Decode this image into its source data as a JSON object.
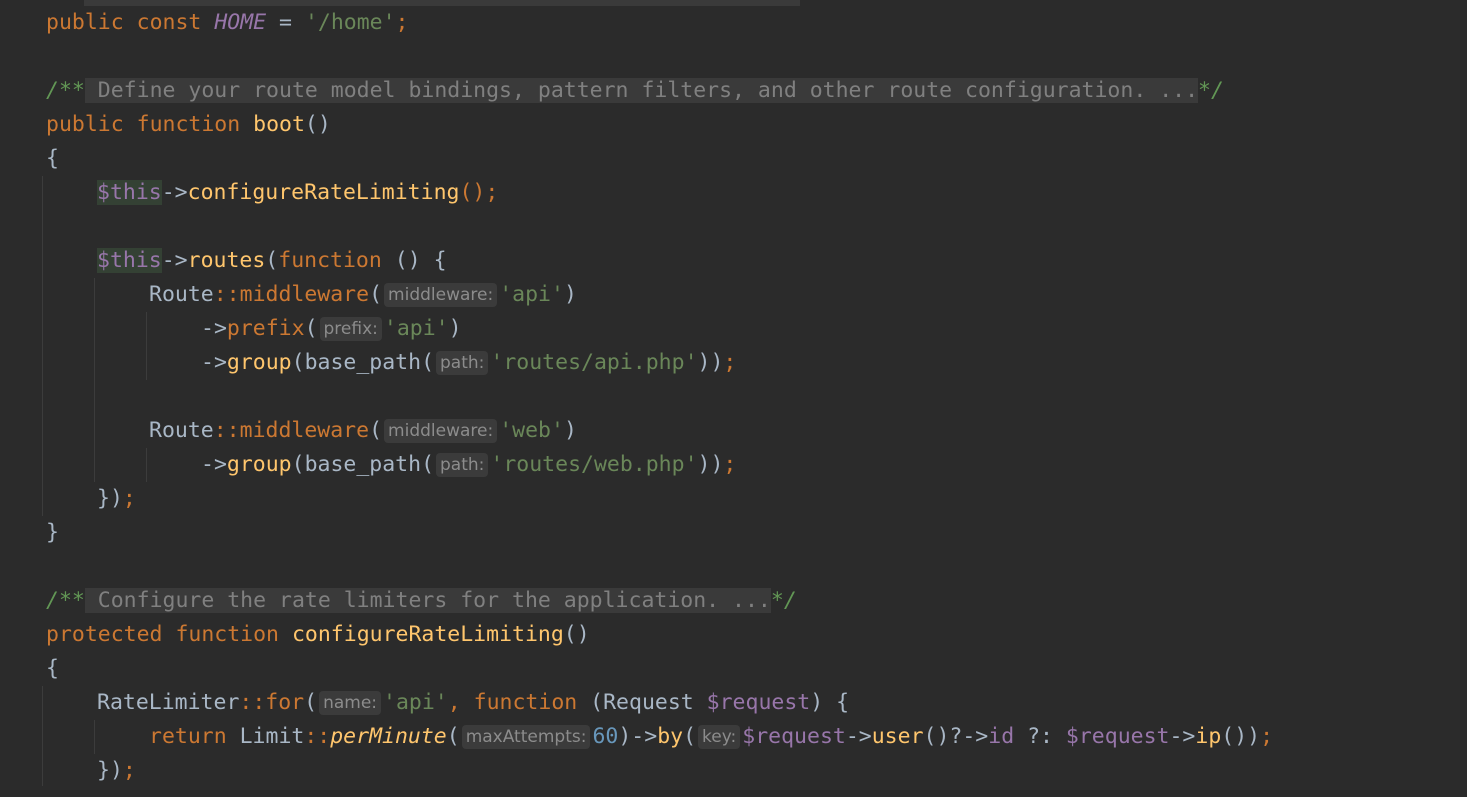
{
  "editor": {
    "l_home": {
      "kw1": "public",
      "kw2": "const",
      "name": "HOME",
      "eq": " = ",
      "val": "'/home'",
      "semi": ";"
    },
    "l_doc1": {
      "open": "/**",
      "text": " Define your route model bindings, pattern filters, and other route configuration. ...",
      "close": "*/"
    },
    "l_boot": {
      "kw1": "public",
      "kw2": "function",
      "name": "boot",
      "parens": "()"
    },
    "l_brace_open": "{",
    "l_crl": {
      "this": "$this",
      "arrow": "->",
      "method": "configureRateLimiting",
      "tail": "();"
    },
    "l_routes": {
      "this": "$this",
      "arrow": "->",
      "method": "routes",
      "paren": "(",
      "kw": "function",
      "tail": " () {"
    },
    "l_mw1": {
      "cls": "Route",
      "sep": "::",
      "method": "middleware",
      "paren": "(",
      "hint": "middleware:",
      "arg": "'api'",
      "close": ")"
    },
    "l_prefix": {
      "arrow": "->",
      "method": "prefix",
      "paren": "(",
      "hint": "prefix:",
      "arg": "'api'",
      "close": ")"
    },
    "l_group1": {
      "arrow": "->",
      "method": "group",
      "open": "(base_path(",
      "hint": "path:",
      "arg": "'routes/api.php'",
      "close": "))",
      "semi": ";"
    },
    "l_mw2": {
      "cls": "Route",
      "sep": "::",
      "method": "middleware",
      "paren": "(",
      "hint": "middleware:",
      "arg": "'web'",
      "close": ")"
    },
    "l_group2": {
      "arrow": "->",
      "method": "group",
      "open": "(base_path(",
      "hint": "path:",
      "arg": "'routes/web.php'",
      "close": "))",
      "semi": ";"
    },
    "l_close_routes": {
      "text": "})",
      "semi": ";"
    },
    "l_brace_close": "}",
    "l_doc2": {
      "open": "/**",
      "text": " Configure the rate limiters for the application. ...",
      "close": "*/"
    },
    "l_crl_def": {
      "kw1": "protected",
      "kw2": "function",
      "name": "configureRateLimiting",
      "parens": "()"
    },
    "l_brace_open2": "{",
    "l_rlfor": {
      "cls": "RateLimiter",
      "sep": "::",
      "method": "for",
      "paren": "(",
      "hint": "name:",
      "arg": "'api'",
      "comma": ", ",
      "kw": "function",
      "sig": " (Request ",
      "var": "$request",
      "tail": ") {"
    },
    "l_return": {
      "kw": "return",
      "cls": " Limit",
      "sep": "::",
      "method": "perMinute",
      "paren": "(",
      "hint1": "maxAttempts:",
      "num": "60",
      "mid": ")->",
      "method2": "by",
      "paren2": "(",
      "hint2": "key:",
      "var1": "$request",
      "arrow1": "->",
      "method3": "user",
      "mid2": "()?->",
      "prop": "id",
      "elvis": " ?: ",
      "var2": "$request",
      "arrow2": "->",
      "method4": "ip",
      "close": "())",
      "semi": ";"
    },
    "l_close_rl": {
      "text": "})",
      "semi": ";"
    }
  }
}
